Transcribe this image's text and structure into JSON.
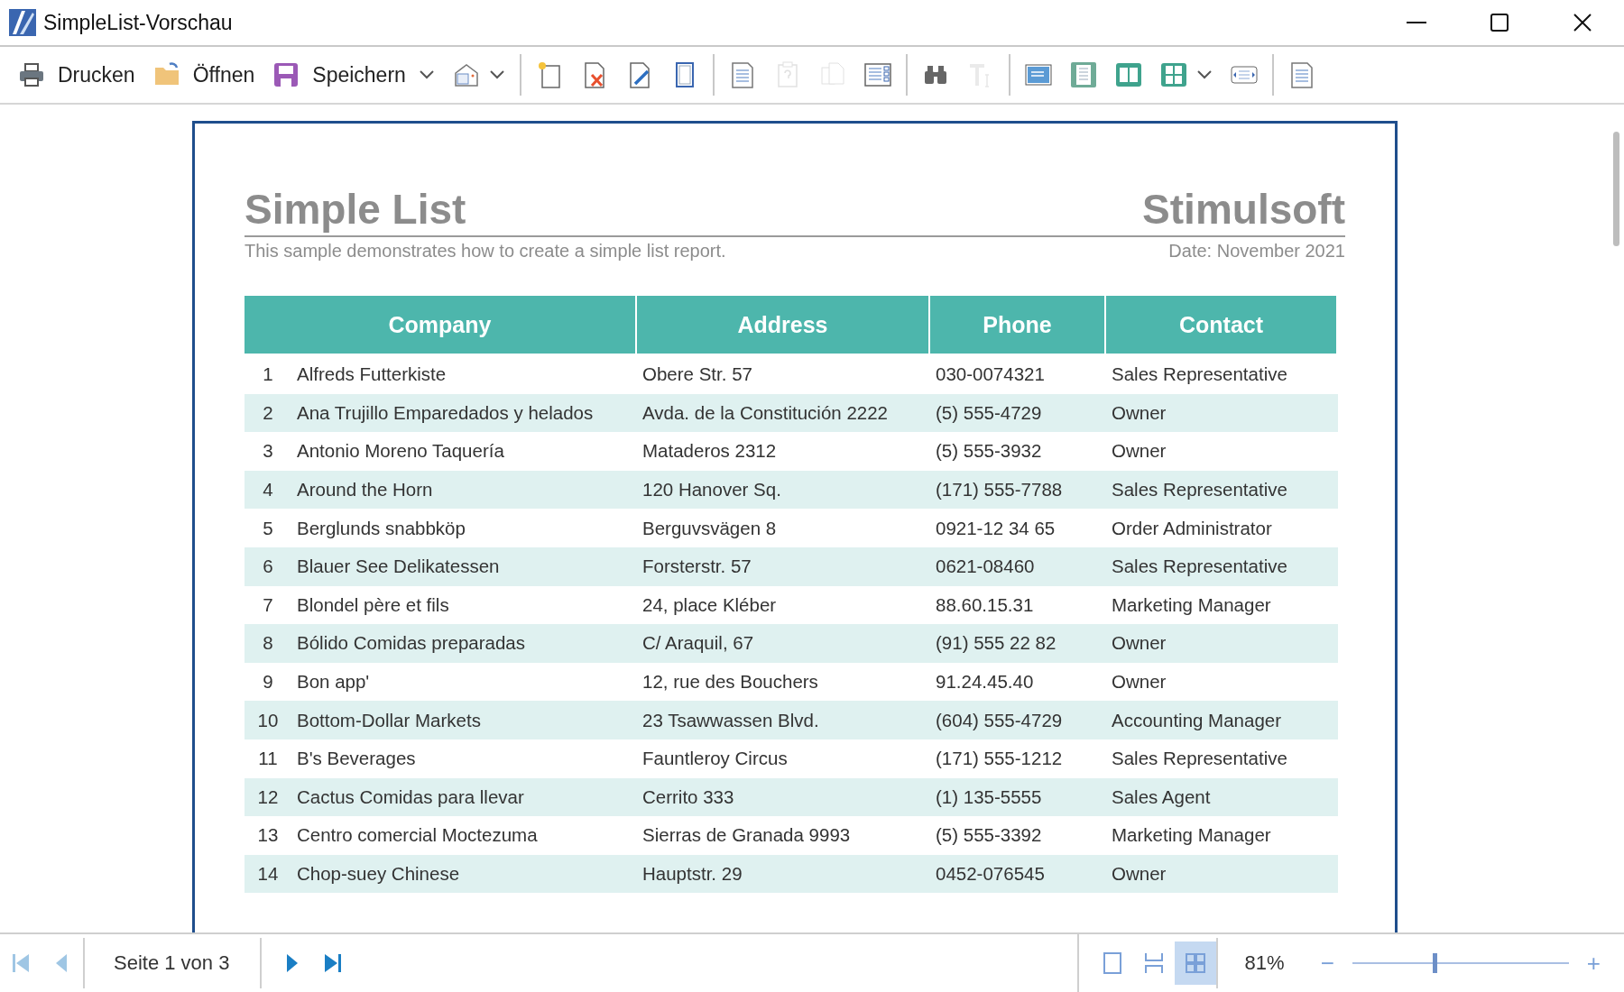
{
  "window": {
    "title": "SimpleList-Vorschau"
  },
  "toolbar": [
    {
      "kind": "labeled",
      "label": "Drucken"
    },
    {
      "kind": "labeled",
      "label": "Öffnen"
    },
    {
      "kind": "labeled",
      "label": "Speichern",
      "dropdown": true
    },
    {
      "kind": "icon",
      "dropdown": true
    },
    {
      "kind": "separator"
    },
    {
      "kind": "icon"
    },
    {
      "kind": "icon"
    },
    {
      "kind": "icon"
    },
    {
      "kind": "icon"
    },
    {
      "kind": "separator"
    },
    {
      "kind": "icon"
    },
    {
      "kind": "icon",
      "disabled": true
    },
    {
      "kind": "icon",
      "disabled": true
    },
    {
      "kind": "icon"
    },
    {
      "kind": "separator"
    },
    {
      "kind": "icon"
    },
    {
      "kind": "icon",
      "disabled": true
    },
    {
      "kind": "separator"
    },
    {
      "kind": "icon"
    },
    {
      "kind": "icon"
    },
    {
      "kind": "icon"
    },
    {
      "kind": "icon",
      "dropdown": true
    },
    {
      "kind": "icon"
    },
    {
      "kind": "separator"
    },
    {
      "kind": "icon"
    }
  ],
  "report": {
    "title": "Simple List",
    "brand": "Stimulsoft",
    "subtitle": "This sample demonstrates how to create a simple list report.",
    "date": "Date: November 2021",
    "columns": [
      "Company",
      "Address",
      "Phone",
      "Contact"
    ],
    "rows": [
      {
        "number": "1",
        "cells": [
          "Alfreds Futterkiste",
          "Obere Str. 57",
          "030-0074321",
          "Sales Representative"
        ]
      },
      {
        "number": "2",
        "cells": [
          "Ana Trujillo Emparedados y helados",
          "Avda. de la Constitución 2222",
          "(5) 555-4729",
          "Owner"
        ]
      },
      {
        "number": "3",
        "cells": [
          "Antonio Moreno Taquería",
          "Mataderos  2312",
          "(5) 555-3932",
          "Owner"
        ]
      },
      {
        "number": "4",
        "cells": [
          "Around the Horn",
          "120 Hanover Sq.",
          "(171) 555-7788",
          "Sales Representative"
        ]
      },
      {
        "number": "5",
        "cells": [
          "Berglunds snabbköp",
          "Berguvsvägen  8",
          "0921-12 34 65",
          "Order Administrator"
        ]
      },
      {
        "number": "6",
        "cells": [
          "Blauer See Delikatessen",
          "Forsterstr. 57",
          "0621-08460",
          "Sales Representative"
        ]
      },
      {
        "number": "7",
        "cells": [
          "Blondel père et fils",
          "24, place Kléber",
          "88.60.15.31",
          "Marketing Manager"
        ]
      },
      {
        "number": "8",
        "cells": [
          "Bólido Comidas preparadas",
          "C/ Araquil, 67",
          "(91) 555 22 82",
          "Owner"
        ]
      },
      {
        "number": "9",
        "cells": [
          "Bon app'",
          "12, rue des Bouchers",
          "91.24.45.40",
          "Owner"
        ]
      },
      {
        "number": "10",
        "cells": [
          "Bottom-Dollar Markets",
          "23 Tsawwassen Blvd.",
          "(604) 555-4729",
          "Accounting Manager"
        ]
      },
      {
        "number": "11",
        "cells": [
          "B's Beverages",
          "Fauntleroy Circus",
          "(171) 555-1212",
          "Sales Representative"
        ]
      },
      {
        "number": "12",
        "cells": [
          "Cactus Comidas para llevar",
          "Cerrito 333",
          "(1) 135-5555",
          "Sales Agent"
        ]
      },
      {
        "number": "13",
        "cells": [
          "Centro comercial Moctezuma",
          "Sierras de Granada 9993",
          "(5) 555-3392",
          "Marketing Manager"
        ]
      },
      {
        "number": "14",
        "cells": [
          "Chop-suey Chinese",
          "Hauptstr. 29",
          "0452-076545",
          "Owner"
        ]
      }
    ]
  },
  "status_bar": {
    "nav": [
      {
        "disabled": true
      },
      {
        "disabled": true
      }
    ],
    "page": "Seite 1 von 3",
    "nav_next": [
      {
        "disabled": false
      },
      {
        "disabled": false
      }
    ],
    "views": [
      {
        "selected": false
      },
      {
        "selected": false
      },
      {
        "selected": true
      }
    ],
    "zoom": "81%",
    "zoom_minus": "−",
    "zoom_plus": "+",
    "zoom_slider": {
      "level": 0.38
    }
  }
}
